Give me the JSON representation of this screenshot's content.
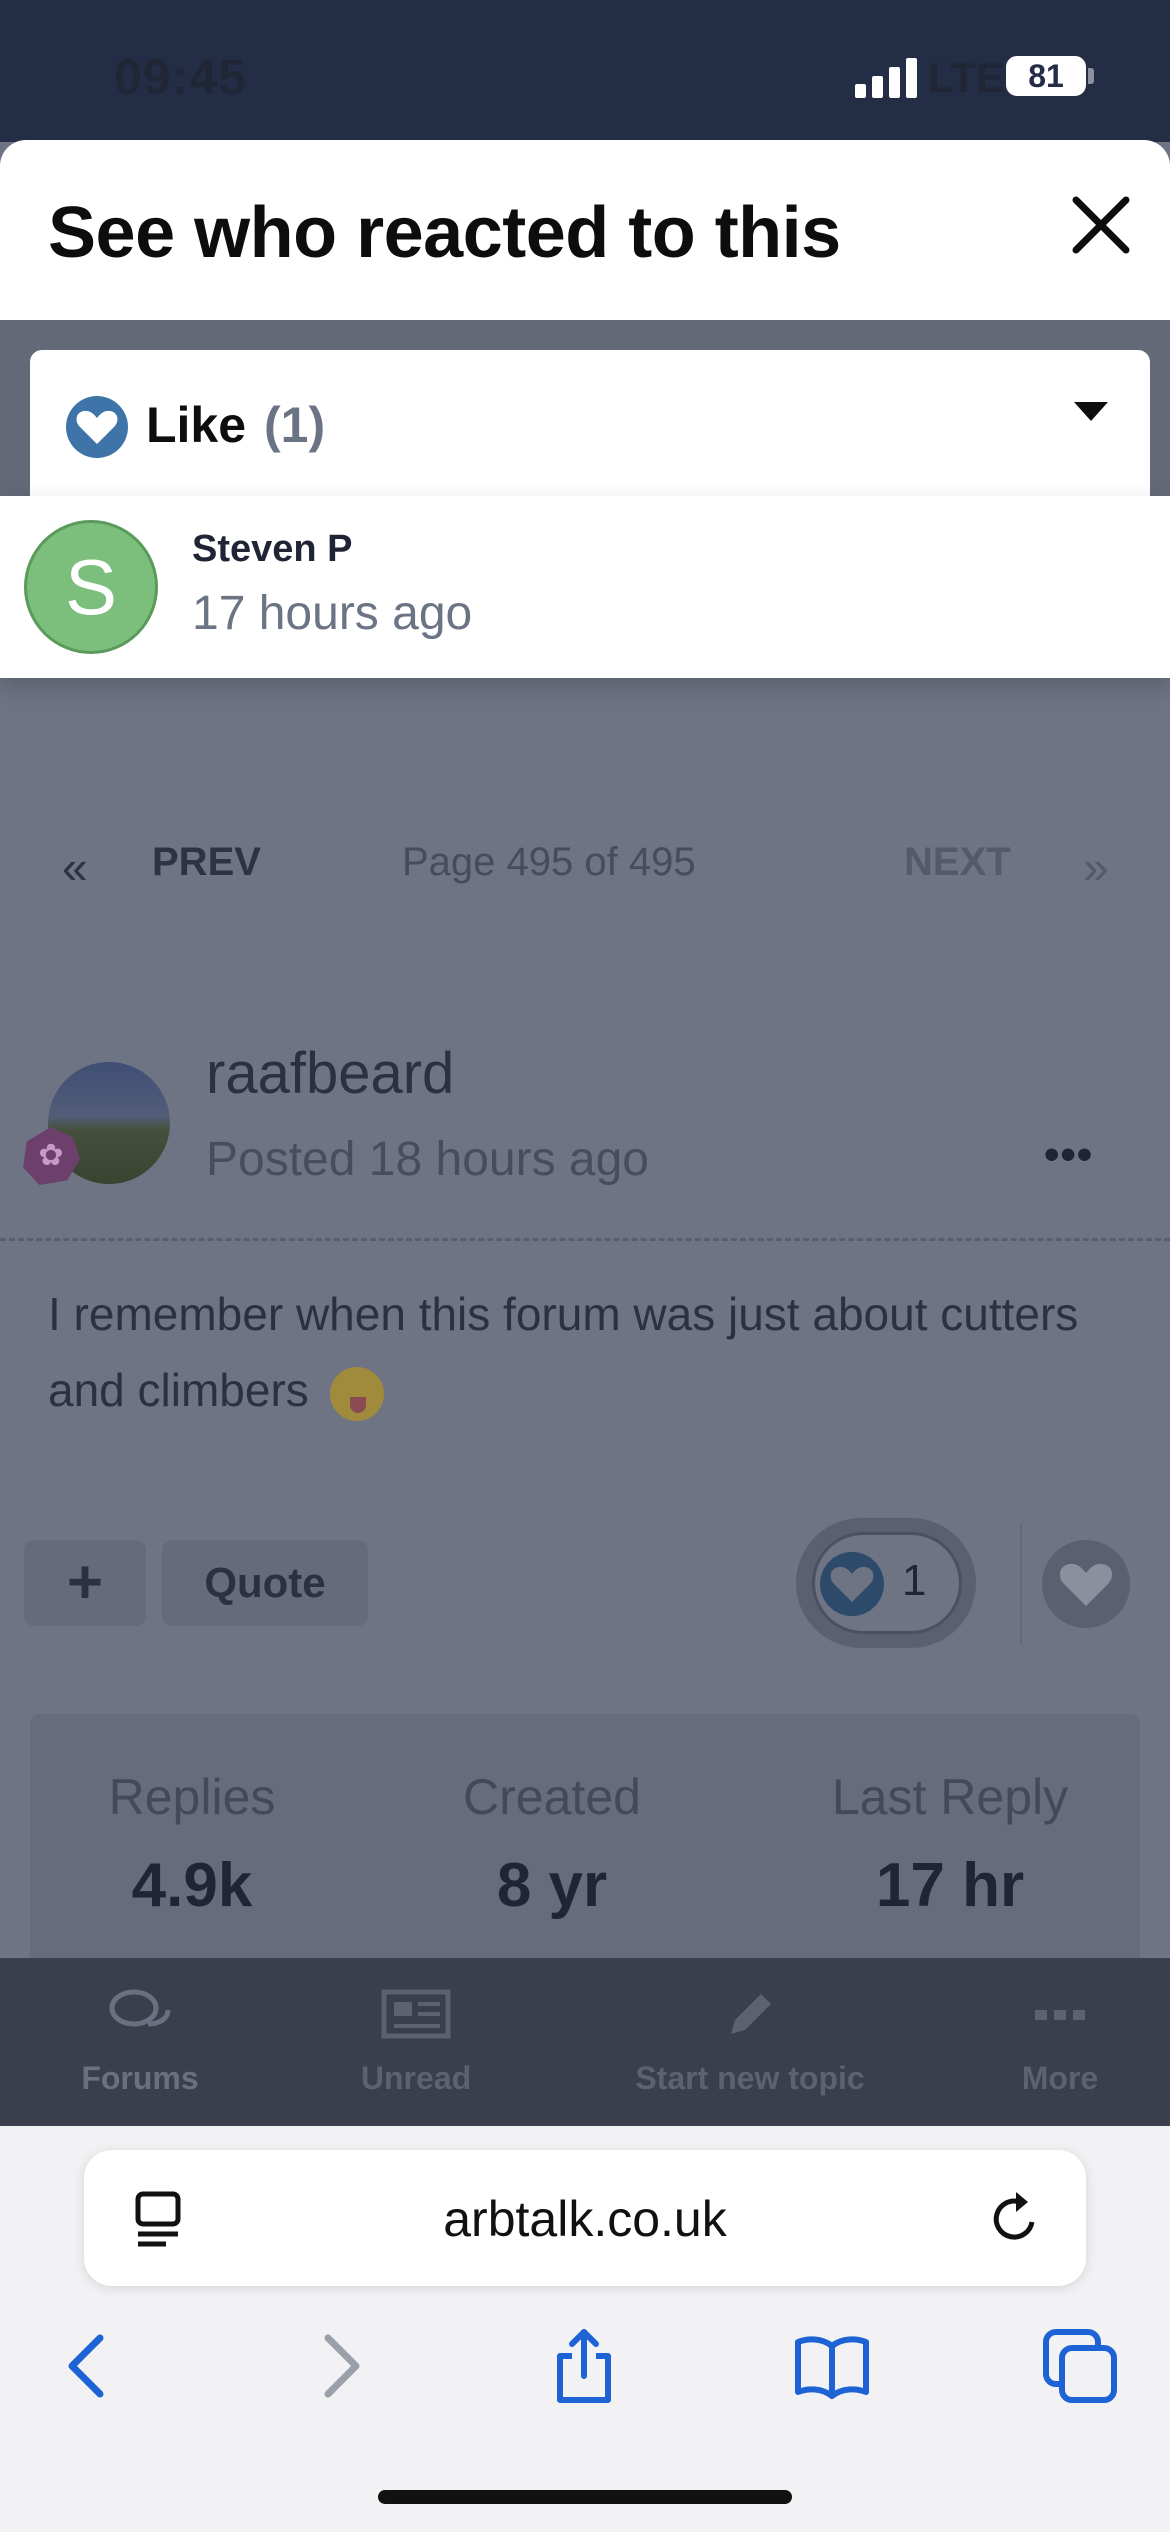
{
  "status_bar": {
    "time": "09:45",
    "network": "LTE",
    "battery": "81"
  },
  "sheet": {
    "title": "See who reacted to this",
    "close_icon": "close-icon",
    "reaction_tab": {
      "label": "Like",
      "count": "(1)",
      "icon": "heart-icon"
    },
    "reactors": [
      {
        "initial": "S",
        "name": "Steven P",
        "time": "17 hours ago",
        "avatar_color": "#7cbf7c"
      }
    ]
  },
  "pagination": {
    "prev_arrows": "«",
    "prev_label": "PREV",
    "info": "Page 495 of 495",
    "next_label": "NEXT",
    "next_arrows": "»"
  },
  "post": {
    "author": "raafbeard",
    "time": "Posted 18 hours ago",
    "menu": "•••",
    "body": "I remember when this forum was just about cutters and climbers",
    "add_label": "+",
    "quote_label": "Quote",
    "reaction_count": "1"
  },
  "stats": [
    {
      "label": "Replies",
      "value": "4.9k"
    },
    {
      "label": "Created",
      "value": "8 yr"
    },
    {
      "label": "Last Reply",
      "value": "17 hr"
    }
  ],
  "tabbar": [
    {
      "label": "Forums",
      "icon": "forums-icon"
    },
    {
      "label": "Unread",
      "icon": "unread-icon"
    },
    {
      "label": "Start new topic",
      "icon": "pencil-icon"
    },
    {
      "label": "More",
      "icon": "more-icon"
    }
  ],
  "browser": {
    "url": "arbtalk.co.uk"
  },
  "colors": {
    "header_bg": "#232d46",
    "like_blue": "#3e74a8",
    "dim_overlay": "#6e7484"
  }
}
